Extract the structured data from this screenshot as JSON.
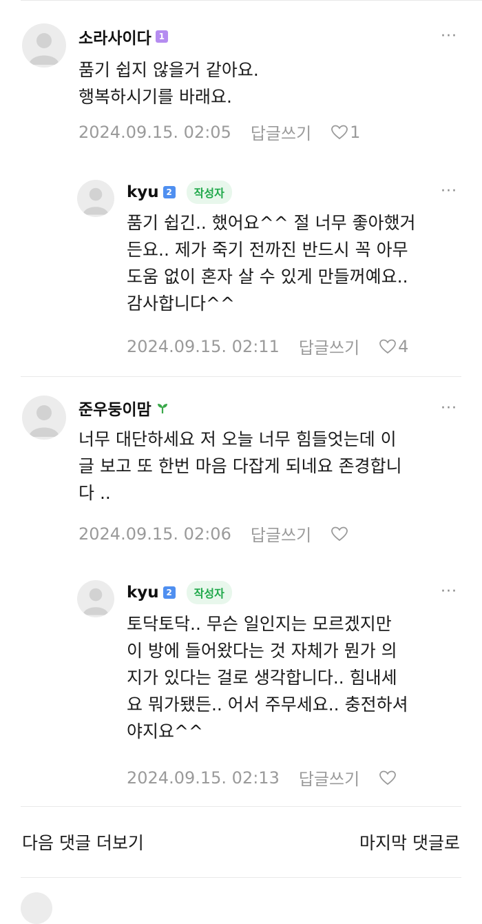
{
  "comments": [
    {
      "author": "소라사이다",
      "level": "1",
      "is_author": false,
      "body": "품기 쉽지 않을거 같아요.\n행복하시기를 바래요.",
      "timestamp": "2024.09.15. 02:05",
      "reply_label": "답글쓰기",
      "likes": "1"
    },
    {
      "author": "kyu",
      "level": "2",
      "is_author": true,
      "badge": "작성자",
      "body": "품기 쉽긴.. 했어요^^ 절 너무 좋아했거\n든요.. 제가 죽기 전까진 반드시 꼭 아무\n도움 없이 혼자 살 수 있게 만들꺼예요..\n감사합니다^^",
      "timestamp": "2024.09.15. 02:11",
      "reply_label": "답글쓰기",
      "likes": "4"
    },
    {
      "author": "준우둥이맘",
      "level_icon": "sprout-icon",
      "is_author": false,
      "body": "너무 대단하세요 저 오늘 너무 힘들엇는데 이\n글 보고 또 한번 마음 다잡게 되네요 존경합니\n다 ..",
      "timestamp": "2024.09.15. 02:06",
      "reply_label": "답글쓰기",
      "likes": ""
    },
    {
      "author": "kyu",
      "level": "2",
      "is_author": true,
      "badge": "작성자",
      "body": "토닥토닥.. 무슨 일인지는 모르겠지만\n이 방에 들어왔다는 것 자체가 뭔가 의\n지가 있다는 걸로 생각합니다.. 힘내세\n요 뭐가됐든.. 어서 주무세요.. 충전하셔\n야지요^^",
      "timestamp": "2024.09.15. 02:13",
      "reply_label": "답글쓰기",
      "likes": ""
    }
  ],
  "more_label": "···",
  "footer": {
    "next_comments": "다음 댓글 더보기",
    "last_comment": "마지막 댓글로"
  },
  "colors": {
    "badge_bg": "#e8f7ec",
    "badge_text": "#1fa84a",
    "level1": "#b58cf0",
    "level2": "#4f8ff0",
    "meta_text": "#9a9a9a"
  }
}
